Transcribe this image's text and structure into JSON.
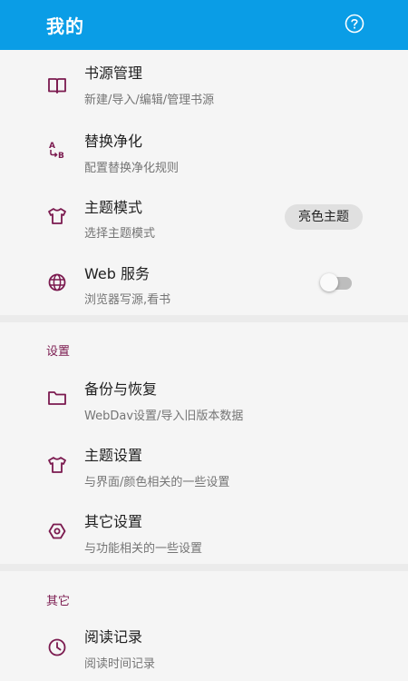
{
  "appbar": {
    "title": "我的",
    "help_icon": "help-circle-icon"
  },
  "colors": {
    "appbar": "#0a9de6",
    "accent": "#7b1a4f"
  },
  "main_items": [
    {
      "title": "书源管理",
      "subtitle": "新建/导入/编辑/管理书源",
      "icon": "book-icon"
    },
    {
      "title": "替换净化",
      "subtitle": "配置替换净化规则",
      "icon": "replace-ab-icon"
    },
    {
      "title": "主题模式",
      "subtitle": "选择主题模式",
      "icon": "tshirt-icon",
      "value": "亮色主题"
    },
    {
      "title": "Web 服务",
      "subtitle": "浏览器写源,看书",
      "icon": "globe-icon",
      "toggle_on": false
    }
  ],
  "settings_section": {
    "title": "设置",
    "items": [
      {
        "title": "备份与恢复",
        "subtitle": "WebDav设置/导入旧版本数据",
        "icon": "folder-icon"
      },
      {
        "title": "主题设置",
        "subtitle": "与界面/颜色相关的一些设置",
        "icon": "tshirt-icon"
      },
      {
        "title": "其它设置",
        "subtitle": "与功能相关的一些设置",
        "icon": "hexagon-settings-icon"
      }
    ]
  },
  "other_section": {
    "title": "其它",
    "items": [
      {
        "title": "阅读记录",
        "subtitle": "阅读时间记录",
        "icon": "clock-icon"
      }
    ]
  }
}
